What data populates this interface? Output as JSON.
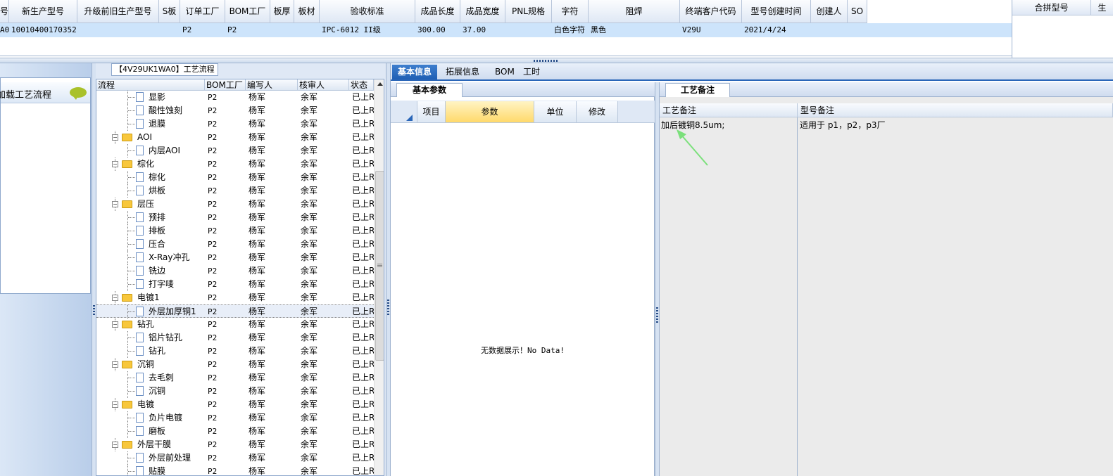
{
  "top_grid": {
    "columns": [
      "号",
      "新生产型号",
      "升级前旧生产型号",
      "S板",
      "订单工厂",
      "BOM工厂",
      "板厚",
      "板材",
      "验收标准",
      "成品长度",
      "成品宽度",
      "PNL规格",
      "字符",
      "阻焊",
      "终端客户代码",
      "型号创建时间",
      "创建人",
      "SO"
    ],
    "row": [
      "A0",
      "10010400170352",
      "",
      "",
      "P2",
      "P2",
      "",
      "",
      "IPC-6012 II级",
      "300.00",
      "37.00",
      "",
      "白色字符",
      "黑色",
      "V29U",
      "2021/4/24",
      "",
      ""
    ],
    "right_header": "合拼型号",
    "right_header_2": "生"
  },
  "left_panel": {
    "load_label": "加载工艺流程",
    "chat_icon": "speech-bubble-icon"
  },
  "process_tree": {
    "title": "【4V29UK1WA0】工艺流程",
    "columns": [
      "流程",
      "BOM工厂",
      "编写人",
      "核审人",
      "状态"
    ],
    "rows": [
      {
        "level": 2,
        "type": "file",
        "name": "显影",
        "bom": "P2",
        "writer": "杨军",
        "reviewer": "余军",
        "status": "已上R"
      },
      {
        "level": 2,
        "type": "file",
        "name": "酸性蚀刻",
        "bom": "P2",
        "writer": "杨军",
        "reviewer": "余军",
        "status": "已上R"
      },
      {
        "level": 2,
        "type": "file",
        "name": "退膜",
        "bom": "P2",
        "writer": "杨军",
        "reviewer": "余军",
        "status": "已上R"
      },
      {
        "level": 1,
        "type": "folder",
        "name": "AOI",
        "bom": "P2",
        "writer": "杨军",
        "reviewer": "余军",
        "status": "已上R"
      },
      {
        "level": 2,
        "type": "file",
        "name": "内层AOI",
        "bom": "P2",
        "writer": "杨军",
        "reviewer": "余军",
        "status": "已上R"
      },
      {
        "level": 1,
        "type": "folder",
        "name": "棕化",
        "bom": "P2",
        "writer": "杨军",
        "reviewer": "余军",
        "status": "已上R"
      },
      {
        "level": 2,
        "type": "file",
        "name": "棕化",
        "bom": "P2",
        "writer": "杨军",
        "reviewer": "余军",
        "status": "已上R"
      },
      {
        "level": 2,
        "type": "file",
        "name": "烘板",
        "bom": "P2",
        "writer": "杨军",
        "reviewer": "余军",
        "status": "已上R"
      },
      {
        "level": 1,
        "type": "folder",
        "name": "层压",
        "bom": "P2",
        "writer": "杨军",
        "reviewer": "余军",
        "status": "已上R"
      },
      {
        "level": 2,
        "type": "file",
        "name": "预排",
        "bom": "P2",
        "writer": "杨军",
        "reviewer": "余军",
        "status": "已上R"
      },
      {
        "level": 2,
        "type": "file",
        "name": "排板",
        "bom": "P2",
        "writer": "杨军",
        "reviewer": "余军",
        "status": "已上R"
      },
      {
        "level": 2,
        "type": "file",
        "name": "压合",
        "bom": "P2",
        "writer": "杨军",
        "reviewer": "余军",
        "status": "已上R"
      },
      {
        "level": 2,
        "type": "file",
        "name": "X-Ray冲孔",
        "bom": "P2",
        "writer": "杨军",
        "reviewer": "余军",
        "status": "已上R"
      },
      {
        "level": 2,
        "type": "file",
        "name": "铣边",
        "bom": "P2",
        "writer": "杨军",
        "reviewer": "余军",
        "status": "已上R"
      },
      {
        "level": 2,
        "type": "file",
        "name": "打字唛",
        "bom": "P2",
        "writer": "杨军",
        "reviewer": "余军",
        "status": "已上R"
      },
      {
        "level": 1,
        "type": "folder",
        "name": "电镀1",
        "bom": "P2",
        "writer": "杨军",
        "reviewer": "余军",
        "status": "已上R"
      },
      {
        "level": 2,
        "type": "file",
        "name": "外层加厚铜1",
        "bom": "P2",
        "writer": "杨军",
        "reviewer": "余军",
        "status": "已上R",
        "selected": true
      },
      {
        "level": 1,
        "type": "folder",
        "name": "钻孔",
        "bom": "P2",
        "writer": "杨军",
        "reviewer": "余军",
        "status": "已上R"
      },
      {
        "level": 2,
        "type": "file",
        "name": "铝片钻孔",
        "bom": "P2",
        "writer": "杨军",
        "reviewer": "余军",
        "status": "已上R"
      },
      {
        "level": 2,
        "type": "file",
        "name": "钻孔",
        "bom": "P2",
        "writer": "杨军",
        "reviewer": "余军",
        "status": "已上R"
      },
      {
        "level": 1,
        "type": "folder",
        "name": "沉铜",
        "bom": "P2",
        "writer": "杨军",
        "reviewer": "余军",
        "status": "已上R"
      },
      {
        "level": 2,
        "type": "file",
        "name": "去毛刺",
        "bom": "P2",
        "writer": "杨军",
        "reviewer": "余军",
        "status": "已上R"
      },
      {
        "level": 2,
        "type": "file",
        "name": "沉铜",
        "bom": "P2",
        "writer": "杨军",
        "reviewer": "余军",
        "status": "已上R"
      },
      {
        "level": 1,
        "type": "folder",
        "name": "电镀",
        "bom": "P2",
        "writer": "杨军",
        "reviewer": "余军",
        "status": "已上R"
      },
      {
        "level": 2,
        "type": "file",
        "name": "负片电镀",
        "bom": "P2",
        "writer": "杨军",
        "reviewer": "余军",
        "status": "已上R"
      },
      {
        "level": 2,
        "type": "file",
        "name": "磨板",
        "bom": "P2",
        "writer": "杨军",
        "reviewer": "余军",
        "status": "已上R"
      },
      {
        "level": 1,
        "type": "folder",
        "name": "外层干膜",
        "bom": "P2",
        "writer": "杨军",
        "reviewer": "余军",
        "status": "已上R"
      },
      {
        "level": 2,
        "type": "file",
        "name": "外层前处理",
        "bom": "P2",
        "writer": "杨军",
        "reviewer": "余军",
        "status": "已上R"
      },
      {
        "level": 2,
        "type": "file",
        "name": "贴膜",
        "bom": "P2",
        "writer": "杨军",
        "reviewer": "余军",
        "status": "已上R"
      }
    ]
  },
  "detail_tabs": [
    "基本信息",
    "拓展信息",
    "BOM",
    "工时"
  ],
  "basic_params": {
    "tab": "基本参数",
    "columns": [
      "项目",
      "参数",
      "单位",
      "修改"
    ],
    "empty_text": "无数据展示！No Data!"
  },
  "process_notes": {
    "tab": "工艺备注",
    "col1": "工艺备注",
    "col2": "型号备注",
    "note1": "加后镀铜8.5um;",
    "note2": "适用于 p1，p2，p3厂"
  },
  "colors": {
    "accent": "#2a66b8",
    "selection": "#cde4fb",
    "arrow": "#7be07b"
  }
}
